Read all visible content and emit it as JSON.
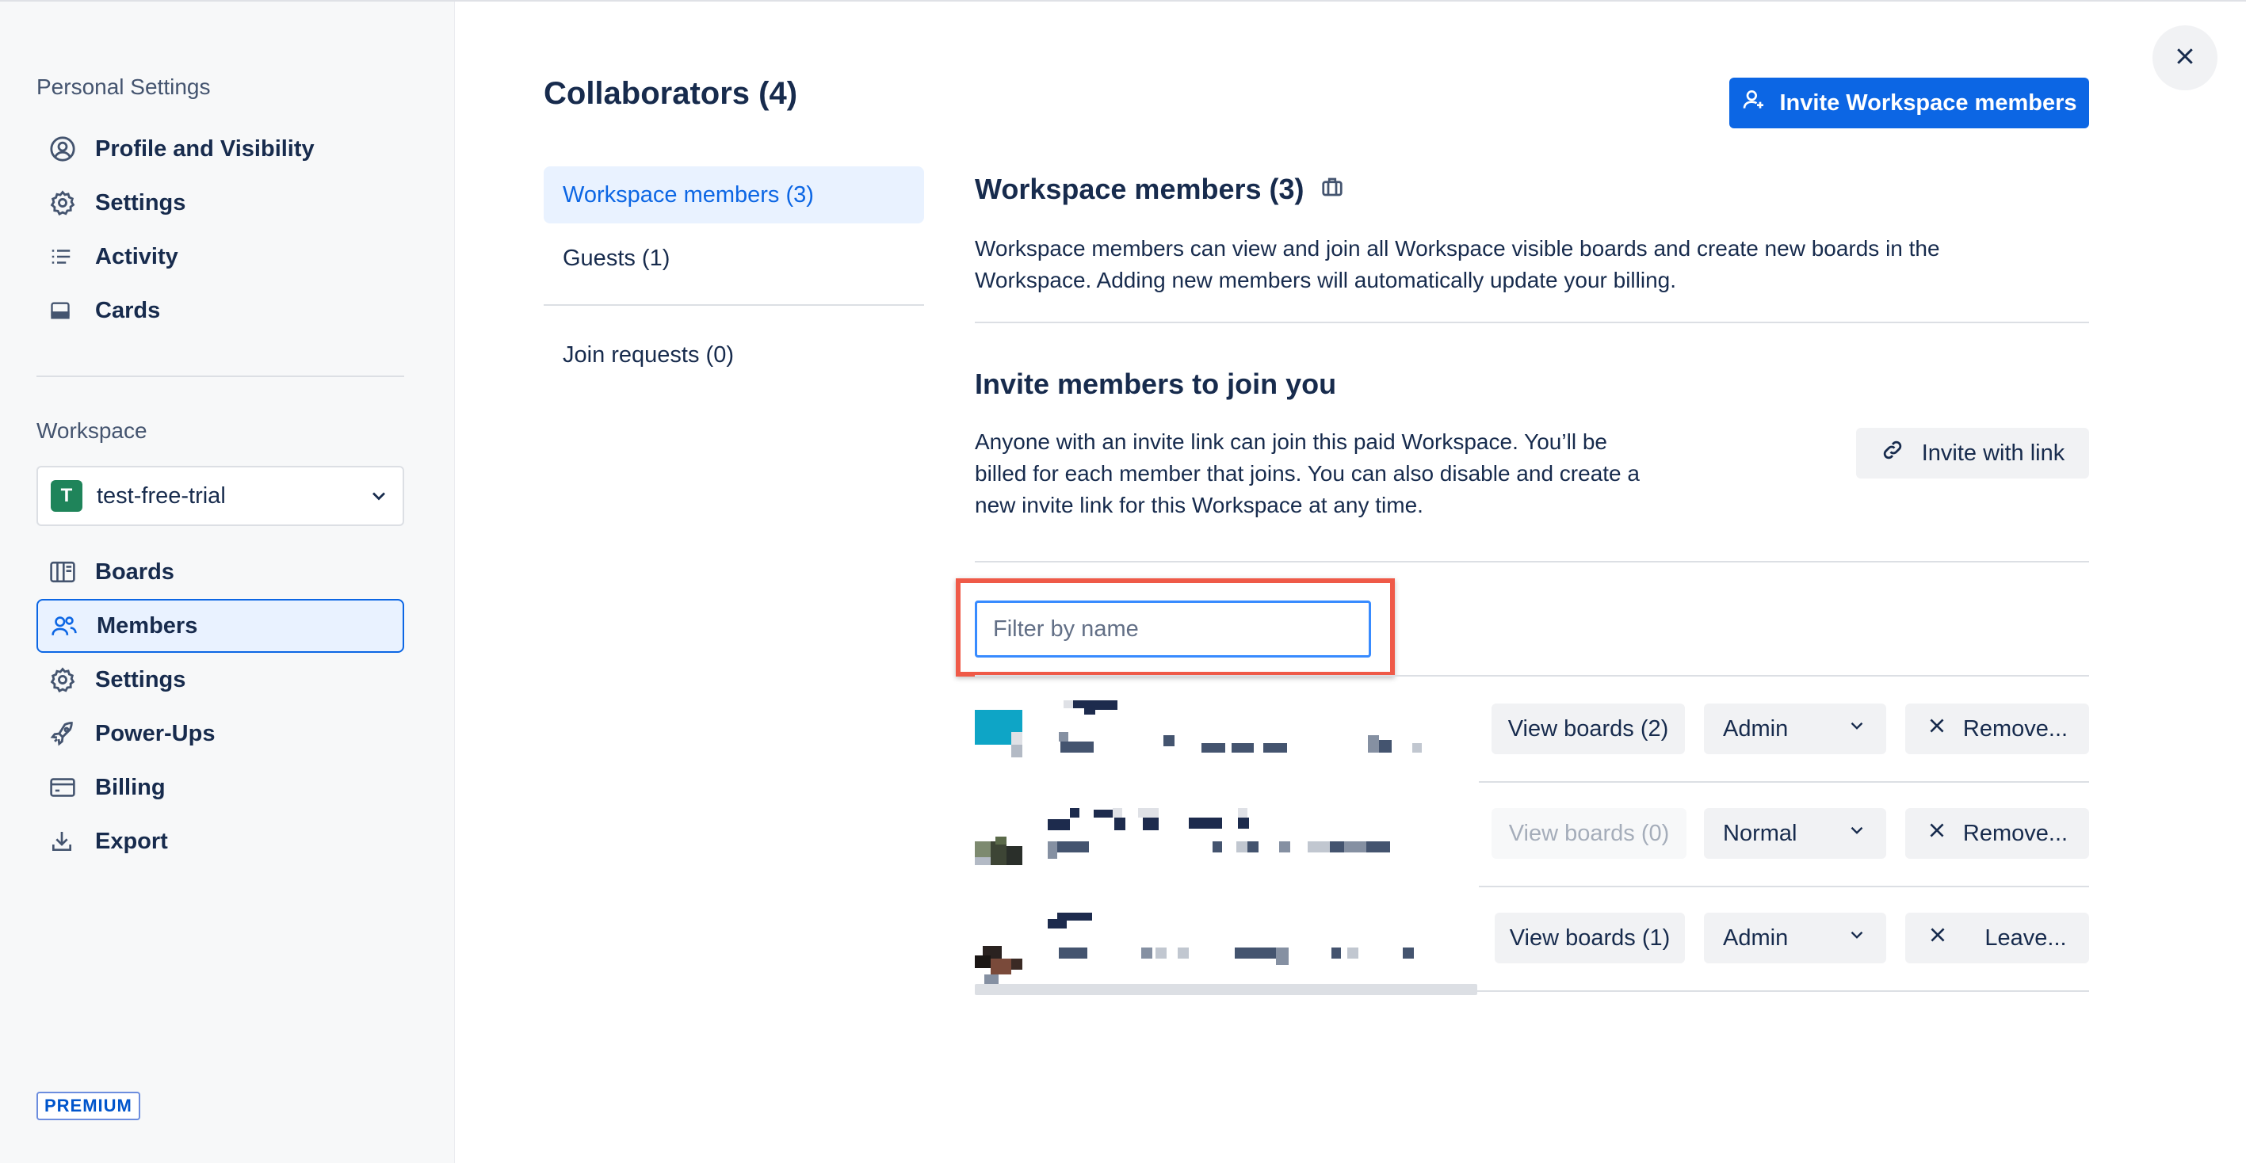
{
  "sidebar": {
    "personal_heading": "Personal Settings",
    "personal_items": [
      {
        "label": "Profile and Visibility",
        "icon": "profile-icon"
      },
      {
        "label": "Settings",
        "icon": "gear-icon"
      },
      {
        "label": "Activity",
        "icon": "activity-list-icon"
      },
      {
        "label": "Cards",
        "icon": "card-icon"
      }
    ],
    "workspace_heading": "Workspace",
    "workspace_select": {
      "avatar_letter": "T",
      "name": "test-free-trial"
    },
    "workspace_items": [
      {
        "label": "Boards",
        "icon": "boards-icon"
      },
      {
        "label": "Members",
        "icon": "members-icon",
        "active": true
      },
      {
        "label": "Settings",
        "icon": "gear-icon"
      },
      {
        "label": "Power-Ups",
        "icon": "rocket-icon"
      },
      {
        "label": "Billing",
        "icon": "credit-card-icon"
      },
      {
        "label": "Export",
        "icon": "download-icon"
      }
    ],
    "badge": "PREMIUM"
  },
  "header": {
    "title": "Collaborators (4)",
    "invite_button": "Invite Workspace members"
  },
  "tabs": [
    {
      "label": "Workspace members (3)",
      "active": true
    },
    {
      "label": "Guests (1)"
    },
    {
      "label": "Join requests (0)"
    }
  ],
  "members_section": {
    "title": "Workspace members (3)",
    "description_line1": "Workspace members can view and join all Workspace visible boards and create new boards in the",
    "description_line2": "Workspace. Adding new members will automatically update your billing."
  },
  "invite_section": {
    "title": "Invite members to join you",
    "line1": "Anyone with an invite link can join this paid Workspace. You’ll be",
    "line2": "billed for each member that joins. You can also disable and create a",
    "line3": "new invite link for this Workspace at any time.",
    "link_button": "Invite with link"
  },
  "filter": {
    "placeholder": "Filter by name"
  },
  "members": [
    {
      "view_boards": "View boards (2)",
      "view_disabled": false,
      "role": "Admin",
      "action": "Remove..."
    },
    {
      "view_boards": "View boards (0)",
      "view_disabled": true,
      "role": "Normal",
      "action": "Remove..."
    },
    {
      "view_boards": "View boards (1)",
      "view_disabled": false,
      "role": "Admin",
      "action": "Leave..."
    }
  ],
  "colors": {
    "accent": "#0c66e4",
    "highlight": "#ef5a48",
    "workspace_avatar": "#1f845a"
  }
}
